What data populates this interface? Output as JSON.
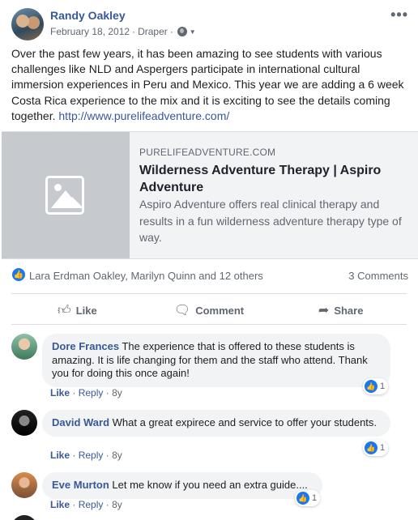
{
  "post": {
    "author": "Randy Oakley",
    "date": "February 18, 2012",
    "location": "Draper",
    "separator": "·",
    "more_icon": "more-options-icon",
    "privacy_icon": "globe-icon",
    "text": "Over the past few years, it has been amazing to see students with various challenges like NLD and Aspergers participate in international cultural immersion experiences in Peru and Mexico. This year we are adding a 6 week Costa Rica experience to the mix and it is exciting to see the details coming together.",
    "link": "http://www.purelifeadventure.com/"
  },
  "preview": {
    "domain": "PURELIFEADVENTURE.COM",
    "title": "Wilderness Adventure Therapy | Aspiro Adventure",
    "description": "Aspiro Adventure offers real clinical therapy and results in a fun wilderness adventure therapy type of way.",
    "thumb_icon": "image-placeholder-icon"
  },
  "reactions": {
    "names": "Lara Erdman Oakley, Marilyn Quinn and 12 others",
    "comments_count": "3 Comments"
  },
  "actions": {
    "like": "Like",
    "comment": "Comment",
    "share": "Share"
  },
  "comments": [
    {
      "name": "Dore Frances",
      "text": "The experience that is offered to these students is amazing. It is life changing for them and the staff who attend. Thank you for doing this once again!",
      "like": "Like",
      "reply": "Reply",
      "age": "8y",
      "reaction_count": "1"
    },
    {
      "name": "David Ward",
      "text": "What a great expirece and service to offer your students.",
      "like": "Like",
      "reply": "Reply",
      "age": "8y",
      "reaction_count": "1"
    },
    {
      "name": "Eve Murton",
      "text": "Let me know if you need an extra guide....",
      "like": "Like",
      "reply": "Reply",
      "age": "8y",
      "reaction_count": "1"
    }
  ],
  "colors": {
    "link": "#385898",
    "like_blue": "#1877f2",
    "bubble": "#f2f3f5"
  }
}
